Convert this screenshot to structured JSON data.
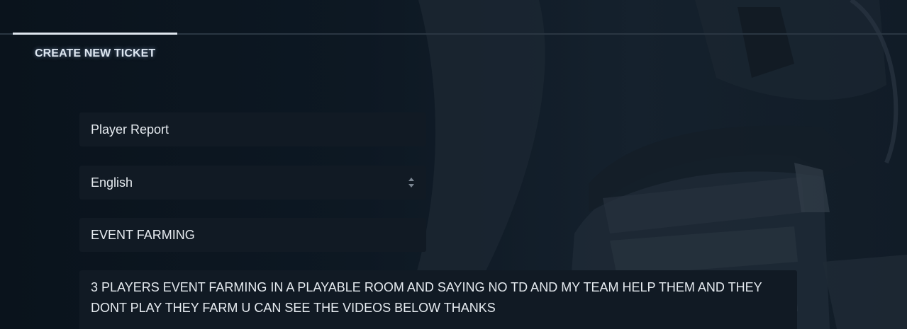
{
  "tabs": [
    {
      "label": "CREATE NEW TICKET",
      "active": true
    }
  ],
  "form": {
    "category": {
      "value": "Player Report"
    },
    "language": {
      "value": "English"
    },
    "subject": {
      "value": "EVENT FARMING"
    },
    "description": {
      "value": "3 PLAYERS EVENT FARMING IN A PLAYABLE ROOM AND SAYING NO TD AND MY TEAM HELP THEM AND THEY DONT PLAY THEY FARM U CAN SEE THE VIDEOS BELOW THANKS"
    }
  },
  "colors": {
    "background": "#0b141d",
    "field_background": "#111a24",
    "text": "#e6ebf0",
    "tab_underline": "#dfe6ee"
  },
  "icons": {
    "select_arrows": "updown-chevrons-icon"
  }
}
